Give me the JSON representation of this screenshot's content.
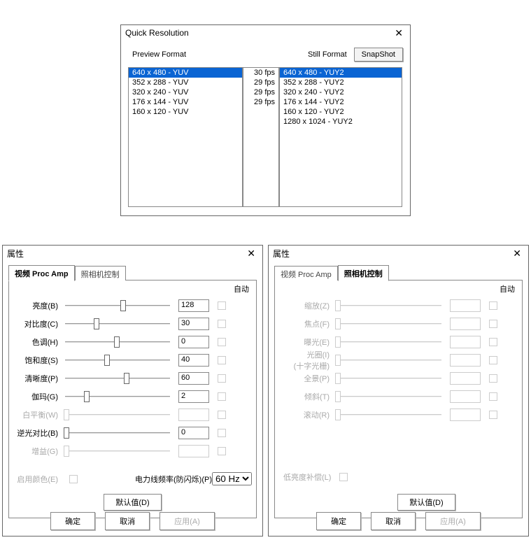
{
  "quick_resolution": {
    "title": "Quick Resolution",
    "preview_format_label": "Preview Format",
    "still_format_label": "Still Format",
    "snapshot_label": "SnapShot",
    "preview_items": [
      "640 x  480 - YUV",
      "352 x  288 - YUV",
      "320 x  240 - YUV",
      "176 x  144 - YUV",
      "160 x  120 - YUV"
    ],
    "fps_items": [
      "30 fps",
      "29 fps",
      "29 fps",
      "29 fps"
    ],
    "still_items": [
      "640 x 480 - YUY2",
      "352 x 288 - YUY2",
      "320 x 240 - YUY2",
      "176 x 144 - YUY2",
      "160 x 120 - YUY2",
      "1280 x 1024 - YUY2"
    ]
  },
  "properties": {
    "title": "属性",
    "tabs": {
      "proc_amp": "视频 Proc Amp",
      "camera_control": "照相机控制"
    },
    "auto_label": "自动",
    "default_button": "默认值(D)",
    "ok": "确定",
    "cancel": "取消",
    "apply": "应用(A)"
  },
  "proc_amp": {
    "sliders": [
      {
        "label": "亮度(B)",
        "value": "128",
        "pos": 56,
        "enabled": true
      },
      {
        "label": "对比度(C)",
        "value": "30",
        "pos": 30,
        "enabled": true
      },
      {
        "label": "色调(H)",
        "value": "0",
        "pos": 50,
        "enabled": true
      },
      {
        "label": "饱和度(S)",
        "value": "40",
        "pos": 40,
        "enabled": true
      },
      {
        "label": "清晰度(P)",
        "value": "60",
        "pos": 60,
        "enabled": true
      },
      {
        "label": "伽玛(G)",
        "value": "2",
        "pos": 20,
        "enabled": true
      },
      {
        "label": "白平衡(W)",
        "value": "",
        "pos": 0,
        "enabled": false
      },
      {
        "label": "逆光对比(B)",
        "value": "0",
        "pos": 0,
        "enabled": true
      },
      {
        "label": "增益(G)",
        "value": "",
        "pos": 0,
        "enabled": false
      }
    ],
    "enable_color_label": "启用颜色(E)",
    "powerline_label": "电力线频率(防闪烁)(P)",
    "powerline_value": "60 Hz"
  },
  "camera_control": {
    "sliders": [
      {
        "label": "缩放(Z)",
        "value": "",
        "pos": 0,
        "enabled": false
      },
      {
        "label": "焦点(F)",
        "value": "",
        "pos": 0,
        "enabled": false
      },
      {
        "label": "曝光(E)",
        "value": "",
        "pos": 0,
        "enabled": false
      },
      {
        "label": "光圈(I)\n(十字光栅)",
        "value": "",
        "pos": 0,
        "enabled": false
      },
      {
        "label": "全景(P)",
        "value": "",
        "pos": 0,
        "enabled": false
      },
      {
        "label": "倾斜(T)",
        "value": "",
        "pos": 0,
        "enabled": false
      },
      {
        "label": "滚动(R)",
        "value": "",
        "pos": 0,
        "enabled": false
      }
    ],
    "low_light_label": "低亮度补偿(L)"
  }
}
